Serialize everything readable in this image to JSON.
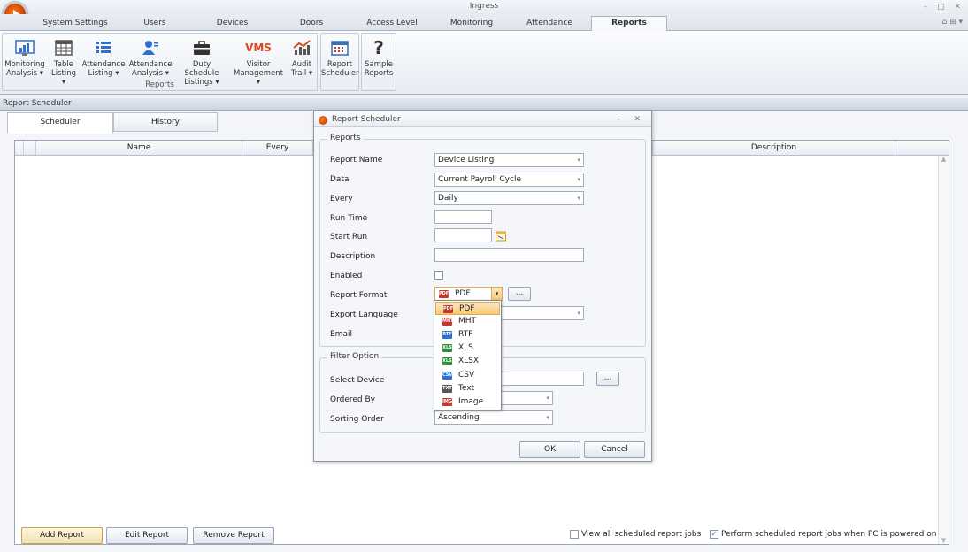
{
  "window": {
    "title": "Ingress",
    "controls": "– □ ✕"
  },
  "tabs": [
    "System Settings",
    "Users",
    "Devices",
    "Doors",
    "Access Level",
    "Monitoring",
    "Attendance",
    "Reports"
  ],
  "active_tab": "Reports",
  "ribbon": {
    "buttons": [
      {
        "name": "monitoring-analysis",
        "label1": "Monitoring",
        "label2": "Analysis ▾",
        "icon": "chart-icon",
        "color": "#2e6fcf"
      },
      {
        "name": "table-listing",
        "label1": "Table",
        "label2": "Listing ▾",
        "icon": "table-icon",
        "color": "#5a5a5a"
      },
      {
        "name": "attendance-listing",
        "label1": "Attendance",
        "label2": "Listing ▾",
        "icon": "list-icon",
        "color": "#2e6fcf"
      },
      {
        "name": "attendance-analysis",
        "label1": "Attendance",
        "label2": "Analysis ▾",
        "icon": "user-icon",
        "color": "#2e6fcf"
      },
      {
        "name": "duty-schedule-listings",
        "label1": "Duty Schedule",
        "label2": "Listings ▾",
        "icon": "briefcase-icon",
        "color": "#333"
      },
      {
        "name": "visitor-management",
        "label1": "Visitor",
        "label2": "Management ▾",
        "icon": "vms-icon",
        "color": "#e0461c"
      },
      {
        "name": "audit-trail",
        "label1": "Audit",
        "label2": "Trail ▾",
        "icon": "audit-chart-icon",
        "color": "#d0501a"
      },
      {
        "name": "report-scheduler",
        "label1": "Report",
        "label2": "Scheduler",
        "icon": "calendar-icon",
        "color": "#3b6bb5"
      },
      {
        "name": "sample-reports",
        "label1": "Sample",
        "label2": "Reports",
        "icon": "question-icon",
        "color": "#333"
      }
    ],
    "group_label": "Reports",
    "vms_text": "VMS",
    "question_text": "?"
  },
  "panel": {
    "title": "Report Scheduler",
    "subtabs": [
      "Scheduler",
      "History"
    ],
    "columns": [
      "Name",
      "Every",
      "Description"
    ],
    "buttons": {
      "add": "Add Report",
      "edit": "Edit Report",
      "remove": "Remove Report"
    },
    "checkboxes": [
      {
        "label": "View all scheduled report jobs",
        "checked": false
      },
      {
        "label": "Perform scheduled report jobs when PC is powered on",
        "checked": true
      }
    ]
  },
  "dialog": {
    "title": "Report Scheduler",
    "controls": "– ✕",
    "reports_legend": "Reports",
    "filter_legend": "Filter Option",
    "labels": {
      "report_name": "Report Name",
      "data": "Data",
      "every": "Every",
      "run_time": "Run Time",
      "start_run": "Start Run",
      "description": "Description",
      "enabled": "Enabled",
      "report_format": "Report Format",
      "export_language": "Export Language",
      "email": "Email",
      "select_device": "Select Device",
      "ordered_by": "Ordered By",
      "sorting_order": "Sorting Order"
    },
    "values": {
      "report_name": "Device Listing",
      "data": "Current Payroll Cycle",
      "every": "Daily",
      "report_format": "PDF",
      "sorting_order": "Ascending"
    },
    "ellipsis": "...",
    "ok": "OK",
    "cancel": "Cancel",
    "format_options": [
      {
        "label": "PDF",
        "color": "#c0392b",
        "tag": "PDF"
      },
      {
        "label": "MHT",
        "color": "#c0392b",
        "tag": "MHT"
      },
      {
        "label": "RTF",
        "color": "#2e6fcf",
        "tag": "RTF"
      },
      {
        "label": "XLS",
        "color": "#2e8b3a",
        "tag": "XLS"
      },
      {
        "label": "XLSX",
        "color": "#2e8b3a",
        "tag": "XLSX"
      },
      {
        "label": "CSV",
        "color": "#2e6fcf",
        "tag": "CSV"
      },
      {
        "label": "Text",
        "color": "#555",
        "tag": "TXT"
      },
      {
        "label": "Image",
        "color": "#c0392b",
        "tag": "IMG"
      }
    ],
    "selected_format": "PDF"
  }
}
